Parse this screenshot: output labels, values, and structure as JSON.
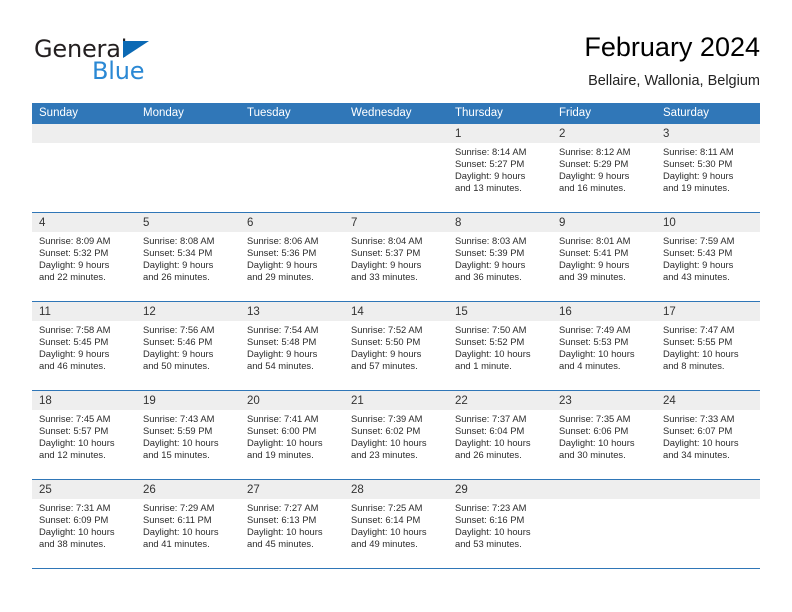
{
  "brand": {
    "name_part1": "General",
    "name_part2": "Blue",
    "triangle_color": "#0b69b4",
    "blue_color": "#2a88d4"
  },
  "header": {
    "title": "February 2024",
    "subtitle": "Bellaire, Wallonia, Belgium"
  },
  "theme": {
    "header_row_bg": "#3077b8",
    "week_divider": "#2f76b7",
    "day_number_band_bg": "#eeeeee"
  },
  "weekdays": [
    "Sunday",
    "Monday",
    "Tuesday",
    "Wednesday",
    "Thursday",
    "Friday",
    "Saturday"
  ],
  "weeks": [
    [
      {
        "day": "",
        "lines": []
      },
      {
        "day": "",
        "lines": []
      },
      {
        "day": "",
        "lines": []
      },
      {
        "day": "",
        "lines": []
      },
      {
        "day": "1",
        "lines": [
          "Sunrise: 8:14 AM",
          "Sunset: 5:27 PM",
          "Daylight: 9 hours",
          "and 13 minutes."
        ]
      },
      {
        "day": "2",
        "lines": [
          "Sunrise: 8:12 AM",
          "Sunset: 5:29 PM",
          "Daylight: 9 hours",
          "and 16 minutes."
        ]
      },
      {
        "day": "3",
        "lines": [
          "Sunrise: 8:11 AM",
          "Sunset: 5:30 PM",
          "Daylight: 9 hours",
          "and 19 minutes."
        ]
      }
    ],
    [
      {
        "day": "4",
        "lines": [
          "Sunrise: 8:09 AM",
          "Sunset: 5:32 PM",
          "Daylight: 9 hours",
          "and 22 minutes."
        ]
      },
      {
        "day": "5",
        "lines": [
          "Sunrise: 8:08 AM",
          "Sunset: 5:34 PM",
          "Daylight: 9 hours",
          "and 26 minutes."
        ]
      },
      {
        "day": "6",
        "lines": [
          "Sunrise: 8:06 AM",
          "Sunset: 5:36 PM",
          "Daylight: 9 hours",
          "and 29 minutes."
        ]
      },
      {
        "day": "7",
        "lines": [
          "Sunrise: 8:04 AM",
          "Sunset: 5:37 PM",
          "Daylight: 9 hours",
          "and 33 minutes."
        ]
      },
      {
        "day": "8",
        "lines": [
          "Sunrise: 8:03 AM",
          "Sunset: 5:39 PM",
          "Daylight: 9 hours",
          "and 36 minutes."
        ]
      },
      {
        "day": "9",
        "lines": [
          "Sunrise: 8:01 AM",
          "Sunset: 5:41 PM",
          "Daylight: 9 hours",
          "and 39 minutes."
        ]
      },
      {
        "day": "10",
        "lines": [
          "Sunrise: 7:59 AM",
          "Sunset: 5:43 PM",
          "Daylight: 9 hours",
          "and 43 minutes."
        ]
      }
    ],
    [
      {
        "day": "11",
        "lines": [
          "Sunrise: 7:58 AM",
          "Sunset: 5:45 PM",
          "Daylight: 9 hours",
          "and 46 minutes."
        ]
      },
      {
        "day": "12",
        "lines": [
          "Sunrise: 7:56 AM",
          "Sunset: 5:46 PM",
          "Daylight: 9 hours",
          "and 50 minutes."
        ]
      },
      {
        "day": "13",
        "lines": [
          "Sunrise: 7:54 AM",
          "Sunset: 5:48 PM",
          "Daylight: 9 hours",
          "and 54 minutes."
        ]
      },
      {
        "day": "14",
        "lines": [
          "Sunrise: 7:52 AM",
          "Sunset: 5:50 PM",
          "Daylight: 9 hours",
          "and 57 minutes."
        ]
      },
      {
        "day": "15",
        "lines": [
          "Sunrise: 7:50 AM",
          "Sunset: 5:52 PM",
          "Daylight: 10 hours",
          "and 1 minute."
        ]
      },
      {
        "day": "16",
        "lines": [
          "Sunrise: 7:49 AM",
          "Sunset: 5:53 PM",
          "Daylight: 10 hours",
          "and 4 minutes."
        ]
      },
      {
        "day": "17",
        "lines": [
          "Sunrise: 7:47 AM",
          "Sunset: 5:55 PM",
          "Daylight: 10 hours",
          "and 8 minutes."
        ]
      }
    ],
    [
      {
        "day": "18",
        "lines": [
          "Sunrise: 7:45 AM",
          "Sunset: 5:57 PM",
          "Daylight: 10 hours",
          "and 12 minutes."
        ]
      },
      {
        "day": "19",
        "lines": [
          "Sunrise: 7:43 AM",
          "Sunset: 5:59 PM",
          "Daylight: 10 hours",
          "and 15 minutes."
        ]
      },
      {
        "day": "20",
        "lines": [
          "Sunrise: 7:41 AM",
          "Sunset: 6:00 PM",
          "Daylight: 10 hours",
          "and 19 minutes."
        ]
      },
      {
        "day": "21",
        "lines": [
          "Sunrise: 7:39 AM",
          "Sunset: 6:02 PM",
          "Daylight: 10 hours",
          "and 23 minutes."
        ]
      },
      {
        "day": "22",
        "lines": [
          "Sunrise: 7:37 AM",
          "Sunset: 6:04 PM",
          "Daylight: 10 hours",
          "and 26 minutes."
        ]
      },
      {
        "day": "23",
        "lines": [
          "Sunrise: 7:35 AM",
          "Sunset: 6:06 PM",
          "Daylight: 10 hours",
          "and 30 minutes."
        ]
      },
      {
        "day": "24",
        "lines": [
          "Sunrise: 7:33 AM",
          "Sunset: 6:07 PM",
          "Daylight: 10 hours",
          "and 34 minutes."
        ]
      }
    ],
    [
      {
        "day": "25",
        "lines": [
          "Sunrise: 7:31 AM",
          "Sunset: 6:09 PM",
          "Daylight: 10 hours",
          "and 38 minutes."
        ]
      },
      {
        "day": "26",
        "lines": [
          "Sunrise: 7:29 AM",
          "Sunset: 6:11 PM",
          "Daylight: 10 hours",
          "and 41 minutes."
        ]
      },
      {
        "day": "27",
        "lines": [
          "Sunrise: 7:27 AM",
          "Sunset: 6:13 PM",
          "Daylight: 10 hours",
          "and 45 minutes."
        ]
      },
      {
        "day": "28",
        "lines": [
          "Sunrise: 7:25 AM",
          "Sunset: 6:14 PM",
          "Daylight: 10 hours",
          "and 49 minutes."
        ]
      },
      {
        "day": "29",
        "lines": [
          "Sunrise: 7:23 AM",
          "Sunset: 6:16 PM",
          "Daylight: 10 hours",
          "and 53 minutes."
        ]
      },
      {
        "day": "",
        "lines": []
      },
      {
        "day": "",
        "lines": []
      }
    ]
  ]
}
